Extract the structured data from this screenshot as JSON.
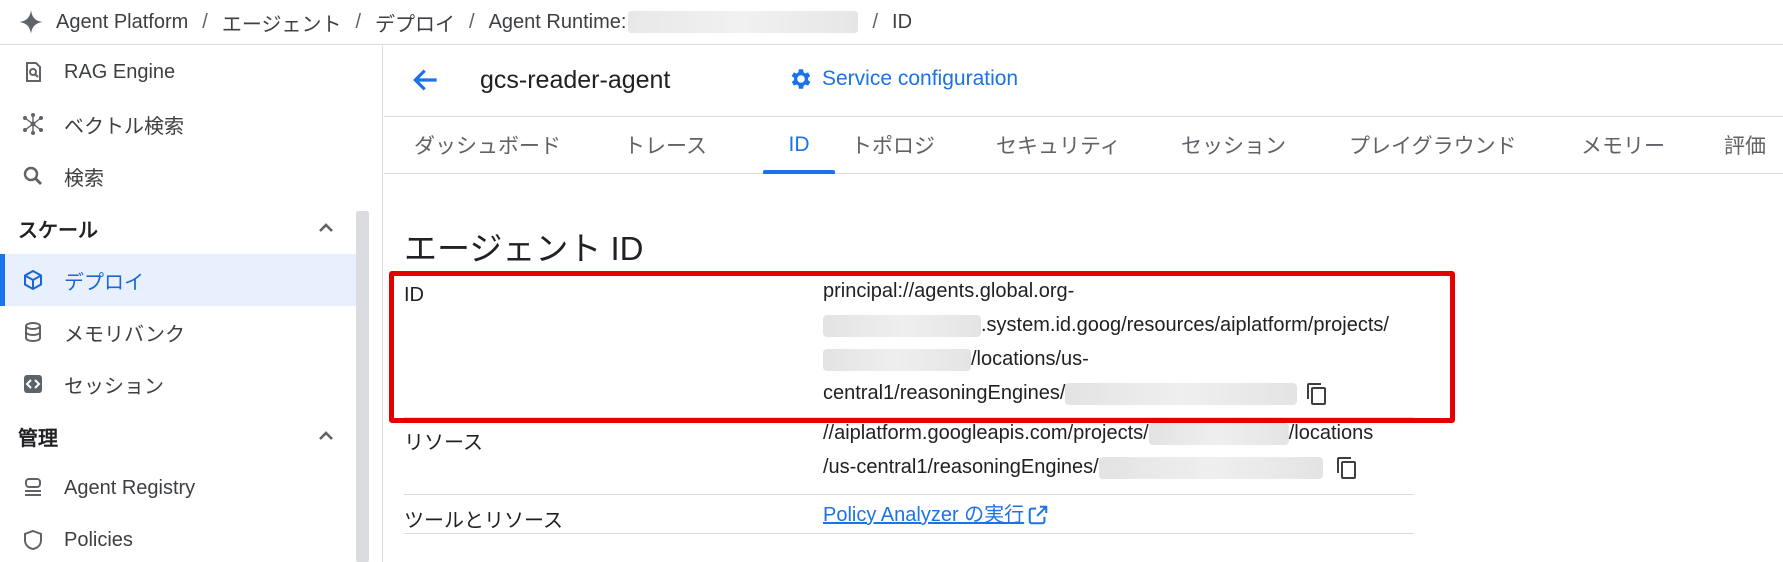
{
  "breadcrumb": {
    "items": [
      "Agent Platform",
      "エージェント",
      "デプロイ",
      "Agent Runtime:",
      "ID"
    ],
    "separator": "/"
  },
  "sidebar": {
    "items_top": [
      {
        "label": "RAG Engine",
        "icon": "rag-engine-icon"
      },
      {
        "label": "ベクトル検索",
        "icon": "vector-search-icon"
      },
      {
        "label": "検索",
        "icon": "search-icon"
      }
    ],
    "section_scale": "スケール",
    "items_scale": [
      {
        "label": "デプロイ",
        "icon": "deploy-cube-icon",
        "active": true
      },
      {
        "label": "メモリバンク",
        "icon": "memory-bank-icon"
      },
      {
        "label": "セッション",
        "icon": "session-icon"
      }
    ],
    "section_manage": "管理",
    "items_manage": [
      {
        "label": "Agent Registry",
        "icon": "agent-registry-icon"
      },
      {
        "label": "Policies",
        "icon": "policies-icon"
      }
    ]
  },
  "header": {
    "agent_name": "gcs-reader-agent",
    "service_config": "Service configuration"
  },
  "tabs": [
    {
      "label": "ダッシュボード"
    },
    {
      "label": "トレース"
    },
    {
      "label": "ID",
      "active": true
    },
    {
      "label": "トポロジ"
    },
    {
      "label": "セキュリティ"
    },
    {
      "label": "セッション"
    },
    {
      "label": "プレイグラウンド"
    },
    {
      "label": "メモリー"
    },
    {
      "label": "評価"
    }
  ],
  "content": {
    "heading": "エージェント ID",
    "id_row": {
      "label": "ID",
      "line1": "principal://agents.global.org-",
      "line2": ".system.id.goog/resources/aiplatform/projects/",
      "line3": "/locations/us-",
      "line4": "central1/reasoningEngines/"
    },
    "resource_row": {
      "label": "リソース",
      "line1a": "//aiplatform.googleapis.com/projects/",
      "line1b": "/locations",
      "line2": "/us-central1/reasoningEngines/"
    },
    "tools_row": {
      "label": "ツールとリソース",
      "link": "Policy Analyzer の実行"
    }
  },
  "colors": {
    "accent": "#1a73e8",
    "highlight_box": "#e50000",
    "active_bg": "#e8f0fe"
  }
}
